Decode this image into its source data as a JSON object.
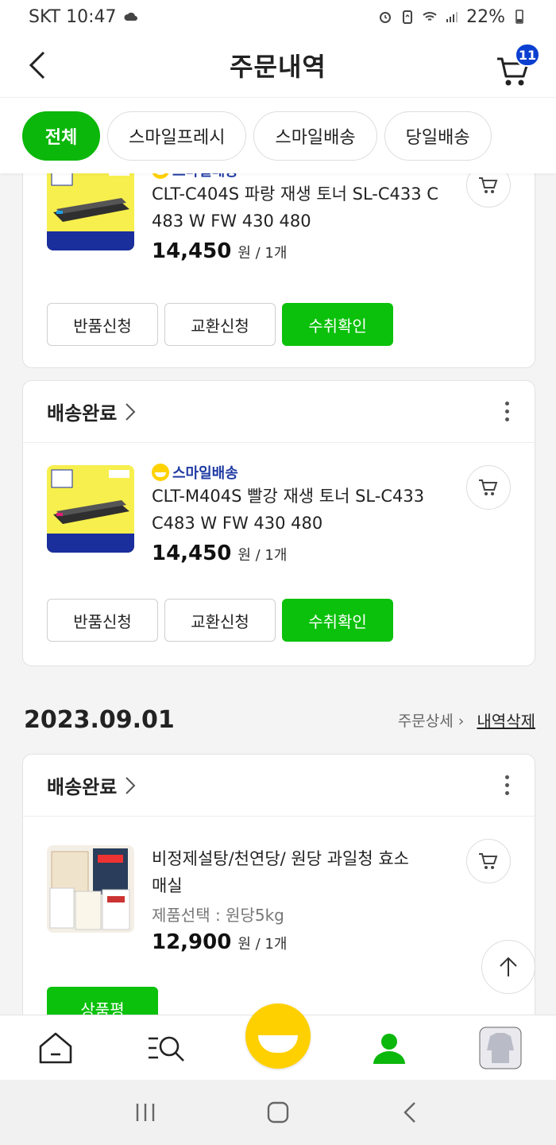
{
  "status_bar": {
    "carrier_time": "SKT 10:47",
    "battery": "22%"
  },
  "header": {
    "title": "주문내역",
    "cart_count": "11"
  },
  "filters": [
    {
      "label": "전체",
      "active": true
    },
    {
      "label": "스마일프레시",
      "active": false
    },
    {
      "label": "스마일배송",
      "active": false
    },
    {
      "label": "당일배송",
      "active": false
    }
  ],
  "orders": {
    "card1": {
      "brand": "스마일배송",
      "name_line1": "CLT-C404S 파랑 재생 토너 SL-C433 C",
      "name_line2": "483 W FW 430 480",
      "price": "14,450",
      "unit": "원 / 1개",
      "buttons": {
        "return": "반품신청",
        "exchange": "교환신청",
        "confirm": "수취확인"
      }
    },
    "card2": {
      "status": "배송완료",
      "brand": "스마일배송",
      "name_line1": "CLT-M404S 빨강 재생 토너 SL-C433",
      "name_line2": "C483 W FW 430 480",
      "price": "14,450",
      "unit": "원 / 1개",
      "buttons": {
        "return": "반품신청",
        "exchange": "교환신청",
        "confirm": "수취확인"
      }
    },
    "group2": {
      "date": "2023.09.01",
      "detail_link": "주문상세 ›",
      "delete_link": "내역삭제"
    },
    "card3": {
      "status": "배송완료",
      "name_line1": "비정제설탕/천연당/ 원당 과일청 효소",
      "name_line2": "매실",
      "option": "제품선택 : 원당5kg",
      "price": "12,900",
      "unit": "원 / 1개",
      "review_button": "상품평"
    }
  },
  "colors": {
    "accent": "#0bc10b",
    "badge": "#0b3fd0",
    "smile": "#ffd000"
  }
}
